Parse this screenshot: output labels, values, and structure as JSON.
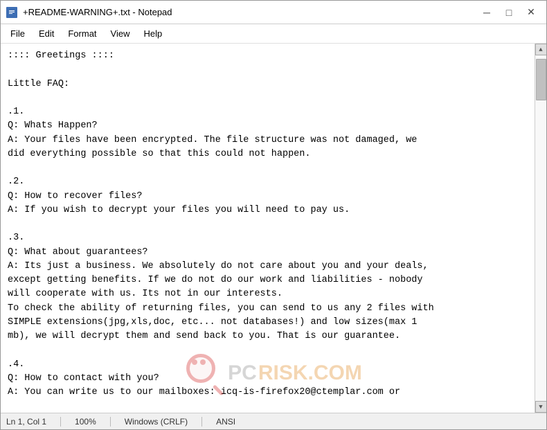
{
  "window": {
    "title": "+README-WARNING+.txt - Notepad",
    "icon": "📄"
  },
  "titlebar": {
    "minimize_label": "─",
    "maximize_label": "□",
    "close_label": "✕"
  },
  "menubar": {
    "items": [
      {
        "label": "File"
      },
      {
        "label": "Edit"
      },
      {
        "label": "Format"
      },
      {
        "label": "View"
      },
      {
        "label": "Help"
      }
    ]
  },
  "content": {
    "text": ":::: Greetings ::::\n\nLittle FAQ:\n\n.1.\nQ: Whats Happen?\nA: Your files have been encrypted. The file structure was not damaged, we\ndid everything possible so that this could not happen.\n\n.2.\nQ: How to recover files?\nA: If you wish to decrypt your files you will need to pay us.\n\n.3.\nQ: What about guarantees?\nA: Its just a business. We absolutely do not care about you and your deals,\nexcept getting benefits. If we do not do our work and liabilities - nobody\nwill cooperate with us. Its not in our interests.\nTo check the ability of returning files, you can send to us any 2 files with\nSIMPLE extensions(jpg,xls,doc, etc... not databases!) and low sizes(max 1\nmb), we will decrypt them and send back to you. That is our guarantee.\n\n.4.\nQ: How to contact with you?\nA: You can write us to our mailboxes: icq-is-firefox20@ctemplar.com or"
  },
  "statusbar": {
    "position": "Ln 1, Col 1",
    "zoom": "100%",
    "line_ending": "Windows (CRLF)",
    "encoding": "ANSI"
  },
  "watermark": {
    "pc_text": "PC",
    "risk_text": "RISK",
    "com_text": ".COM"
  }
}
